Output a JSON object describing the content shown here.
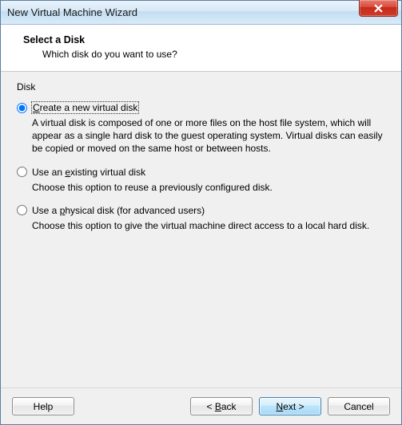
{
  "window": {
    "title": "New Virtual Machine Wizard",
    "close_icon": "close-icon"
  },
  "header": {
    "title": "Select a Disk",
    "subtitle": "Which disk do you want to use?"
  },
  "group_label": "Disk",
  "options": [
    {
      "id": "create",
      "label_pre": "",
      "accel": "C",
      "label_post": "reate a new virtual disk",
      "desc": "A virtual disk is composed of one or more files on the host file system, which will appear as a single hard disk to the guest operating system. Virtual disks can easily be copied or moved on the same host or between hosts.",
      "selected": true
    },
    {
      "id": "existing",
      "label_pre": "Use an ",
      "accel": "e",
      "label_post": "xisting virtual disk",
      "desc": "Choose this option to reuse a previously configured disk.",
      "selected": false
    },
    {
      "id": "physical",
      "label_pre": "Use a ",
      "accel": "p",
      "label_post": "hysical disk (for advanced users)",
      "desc": "Choose this option to give the virtual machine direct access to a local hard disk.",
      "selected": false
    }
  ],
  "buttons": {
    "help": "Help",
    "back": "< Back",
    "next": "Next >",
    "cancel": "Cancel",
    "back_accel": "B",
    "next_accel": "N"
  }
}
